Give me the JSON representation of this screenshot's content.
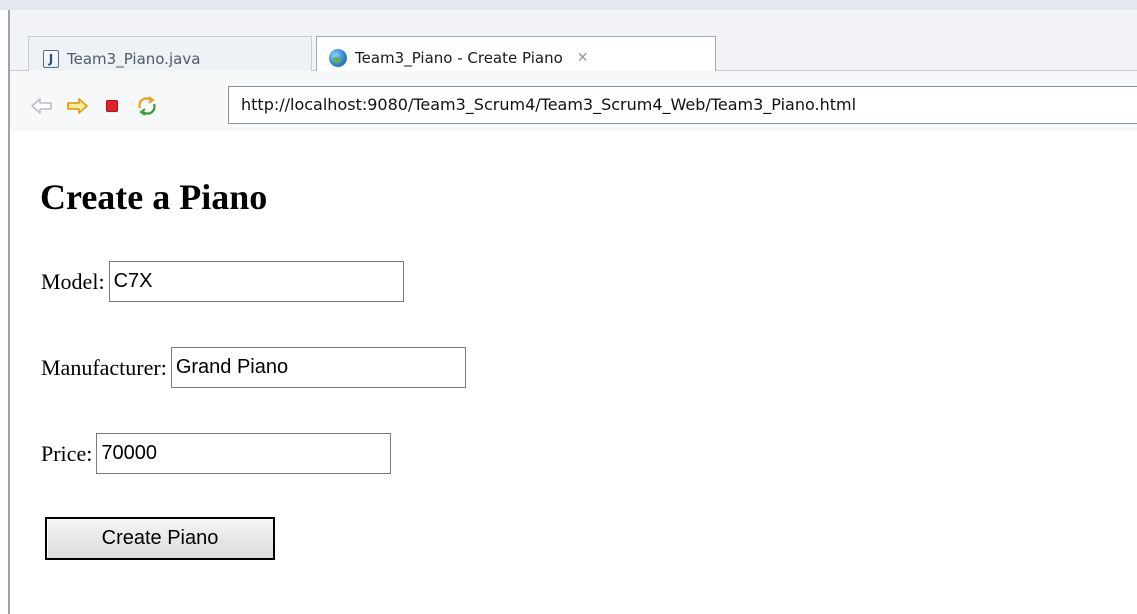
{
  "tabs": [
    {
      "label": "Team3_Piano.java",
      "icon": "java-file-icon",
      "active": false
    },
    {
      "label": "Team3_Piano - Create Piano",
      "icon": "globe-icon",
      "active": true
    }
  ],
  "toolbar": {
    "url": "http://localhost:9080/Team3_Scrum4/Team3_Scrum4_Web/Team3_Piano.html",
    "buttons": [
      "back-icon",
      "forward-icon",
      "stop-icon",
      "refresh-icon"
    ]
  },
  "page": {
    "title": "Create a Piano",
    "fields": [
      {
        "label": "Model:",
        "value": "C7X"
      },
      {
        "label": "Manufacturer:",
        "value": "Grand Piano"
      },
      {
        "label": "Price:",
        "value": "70000"
      }
    ],
    "submit_label": "Create Piano"
  },
  "colors": {
    "tab_bar": "#f1f3f6",
    "forward_arrow": "#f2b31a",
    "stop": "#e0242b"
  }
}
